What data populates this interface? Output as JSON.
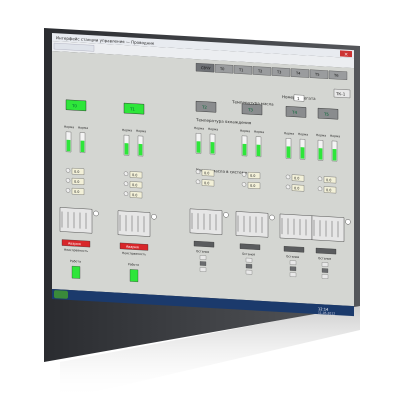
{
  "window": {
    "title_text": "Интерфейс станции управления — Проводник",
    "taskbar_clock": "12:14",
    "taskbar_date": "11.05.2012"
  },
  "top_bar": {
    "buttons": [
      "СВЧУ",
      "Т0",
      "Т1",
      "Т2",
      "Т3",
      "Т4",
      "Т5",
      "Т6"
    ],
    "active_button_index": 0,
    "close_label": "×"
  },
  "mode_panel": {
    "caption": "Номер агрегата",
    "value": "1",
    "corner_label": "ТК-1"
  },
  "headers": {
    "section_main": "Температура масла",
    "section_second": "Температура охлаждения",
    "section_third": "Уровни масла в системе"
  },
  "units": [
    {
      "id": "u1",
      "tag": "Т0",
      "status": "ok",
      "levels": [
        "Норма",
        "Норма"
      ],
      "values": [
        "0.0",
        "0.0",
        "0.0"
      ],
      "alarm": "Авария",
      "alarm_sub": "Неисправность",
      "lamp_label": "Работа"
    },
    {
      "id": "u2",
      "tag": "Т1",
      "status": "ok",
      "levels": [
        "Норма",
        "Норма"
      ],
      "values": [
        "0.0",
        "0.0",
        "0.0"
      ],
      "alarm": "Авария",
      "alarm_sub": "Неисправность",
      "lamp_label": "Работа"
    },
    {
      "id": "u3",
      "tag": "Т2",
      "status": "off",
      "levels": [
        "Норма",
        "Норма"
      ],
      "values": [
        "0.0",
        "0.0"
      ],
      "lamp_label": "Останов"
    },
    {
      "id": "u4",
      "tag": "Т3",
      "status": "off",
      "levels": [
        "Норма",
        "Норма"
      ],
      "values": [
        "0.0",
        "0.0"
      ],
      "lamp_label": "Останов"
    },
    {
      "id": "u5",
      "tag": "Т4",
      "status": "off",
      "levels": [
        "Норма",
        "Норма"
      ],
      "values": [
        "0.0",
        "0.0"
      ],
      "lamp_label": "Останов"
    },
    {
      "id": "u6",
      "tag": "Т5",
      "status": "off",
      "levels": [
        "Норма",
        "Норма"
      ],
      "values": [
        "0.0",
        "0.0"
      ],
      "lamp_label": "Останов"
    }
  ],
  "colors": {
    "panel_bg": "#d4d6d2",
    "frame": "#3c3e42",
    "green": "#2ee63a",
    "red": "#d8262a",
    "dark_btn": "#5a5c5e",
    "title_blue": "#2c5c9c",
    "taskbar": "#1b3a6c"
  }
}
